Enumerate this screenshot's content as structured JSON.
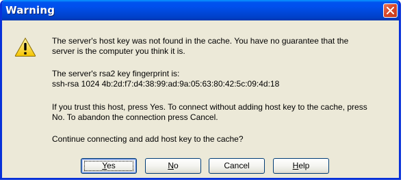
{
  "window": {
    "title": "Warning",
    "close_icon": "close-icon"
  },
  "message": {
    "icon": "warning-icon",
    "line1": "The server's host key was not found in the cache. You have no guarantee that the",
    "line2": "server is the computer you think it is.",
    "line3": "The server's rsa2 key fingerprint is:",
    "line4": "ssh-rsa 1024 4b:2d:f7:d4:38:99:ad:9a:05:63:80:42:5c:09:4d:18",
    "line5": "If you trust this host, press Yes. To connect without adding host key to the cache, press",
    "line6": "No. To abandon the connection press Cancel.",
    "line7": "Continue connecting and add host key to the cache?"
  },
  "buttons": {
    "yes": {
      "mnemonic": "Y",
      "rest": "es"
    },
    "no": {
      "mnemonic": "N",
      "rest": "o"
    },
    "cancel": {
      "label": "Cancel"
    },
    "help": {
      "mnemonic": "H",
      "rest": "elp"
    }
  },
  "colors": {
    "title_bar": "#0050ee",
    "frame": "#0831d9",
    "dialog_bg": "#ece9d8",
    "close_button": "#d8492b"
  }
}
